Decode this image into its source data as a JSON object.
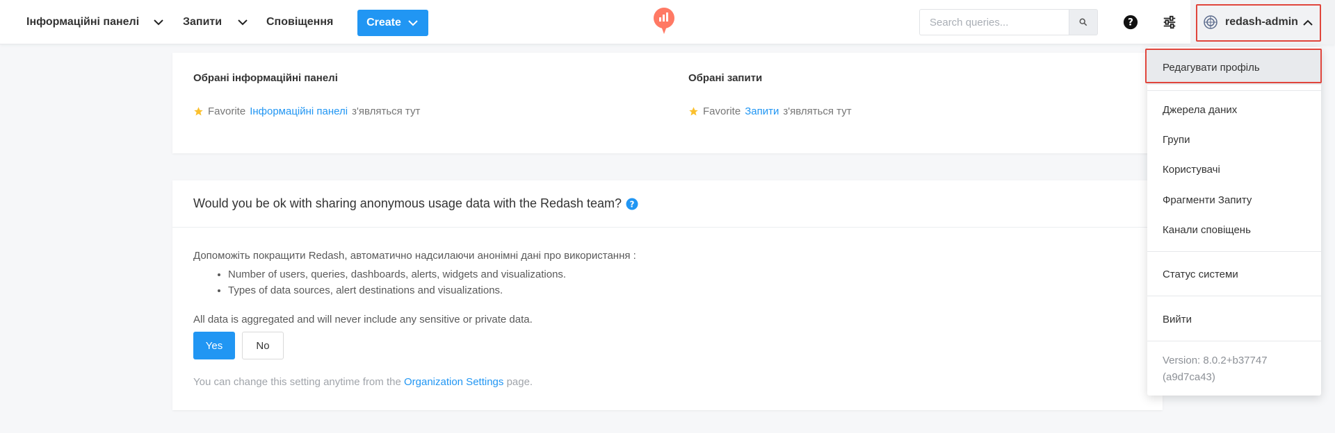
{
  "navbar": {
    "dashboards_label": "Інформаційні панелі",
    "queries_label": "Запити",
    "alerts_label": "Сповіщення",
    "create_label": "Create",
    "search_placeholder": "Search queries...",
    "username": "redash-admin"
  },
  "favorites": {
    "dashboards_title": "Обрані інформаційні панелі",
    "dashboards_prefix": "Favorite",
    "dashboards_link": "Інформаційні панелі",
    "dashboards_suffix": "з'являться тут",
    "queries_title": "Обрані запити",
    "queries_prefix": "Favorite",
    "queries_link": "Запити",
    "queries_suffix": "з'являться тут"
  },
  "beacon": {
    "title": "Would you be ok with sharing anonymous usage data with the Redash team?",
    "intro": "Допоможіть покращити Redash, автоматично надсилаючи анонімні дані про використання :",
    "bullets": [
      "Number of users, queries, dashboards, alerts, widgets and visualizations.",
      "Types of data sources, alert destinations and visualizations."
    ],
    "aggregated": "All data is aggregated and will never include any sensitive or private data.",
    "yes_label": "Yes",
    "no_label": "No",
    "note_prefix": "You can change this setting anytime from the",
    "note_link": "Organization Settings",
    "note_suffix": "page."
  },
  "dropdown": {
    "edit_profile": "Редагувати профіль",
    "data_sources": "Джерела даних",
    "groups": "Групи",
    "users": "Користувачі",
    "query_snippets": "Фрагменти Запиту",
    "alert_destinations": "Канали сповіщень",
    "system_status": "Статус системи",
    "logout": "Вийти",
    "version_line1": "Version: 8.0.2+b37747",
    "version_line2": "(a9d7ca43)"
  },
  "colors": {
    "accent": "#2196f3",
    "logo": "#ff7964",
    "highlight_border": "#e0453c",
    "star": "#fbc02d"
  }
}
